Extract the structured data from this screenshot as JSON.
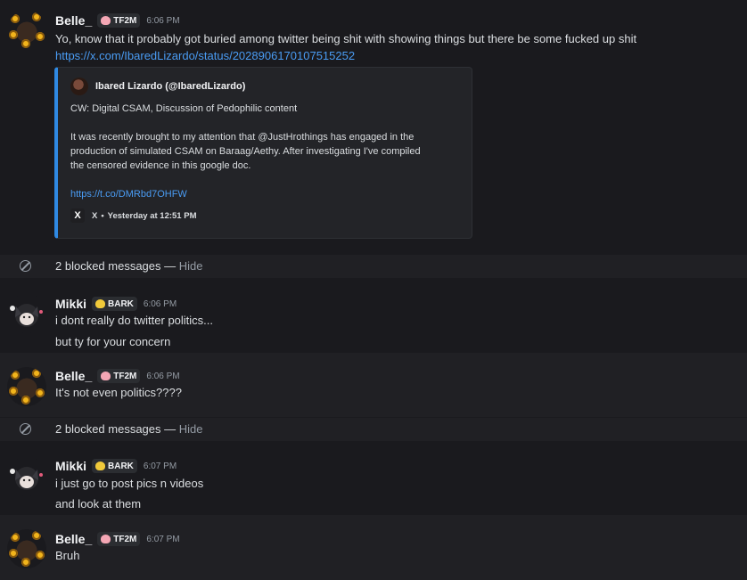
{
  "messages": [
    {
      "username": "Belle_",
      "tag": "TF2M",
      "time": "6:06 PM",
      "lines": [
        "Yo, know that it probably got buried among twitter being shit with showing things but there be some fucked up shit"
      ],
      "link": "https://x.com/IbaredLizardo/status/2028906170107515252",
      "embed": {
        "author": "Ibared Lizardo (@IbaredLizardo)",
        "lines": [
          "CW: Digital CSAM, Discussion of Pedophilic content",
          "It was recently brought to my attention that @JustHrothings has engaged in the",
          "production of simulated CSAM on Baraag/Aethy. After investigating I've compiled",
          "the censored evidence in this google doc."
        ],
        "link": "https://t.co/DMRbd7OHFW",
        "footer_source": "X",
        "footer_time": "Yesterday at 12:51 PM"
      }
    },
    {
      "blocked": "2 blocked messages",
      "hide": "Hide"
    },
    {
      "username": "Mikki",
      "tag": "BARK",
      "time": "6:06 PM",
      "lines": [
        "i dont really do twitter politics...",
        "but ty for your concern"
      ]
    },
    {
      "username": "Belle_",
      "tag": "TF2M",
      "time": "6:06 PM",
      "lines": [
        "It's not even politics????"
      ]
    },
    {
      "blocked": "2 blocked messages",
      "hide": "Hide"
    },
    {
      "username": "Mikki",
      "tag": "BARK",
      "time": "6:07 PM",
      "lines": [
        "i just go to post pics n videos",
        "and look at them"
      ]
    },
    {
      "username": "Belle_",
      "tag": "TF2M",
      "time": "6:07 PM",
      "lines": [
        "Bruh"
      ]
    }
  ],
  "colors": {
    "link": "#4a9cf4",
    "embed_accent": "#2f89e3",
    "tf2m_icon": "#f4a6b4",
    "bark_icon": "#f0c93a"
  }
}
